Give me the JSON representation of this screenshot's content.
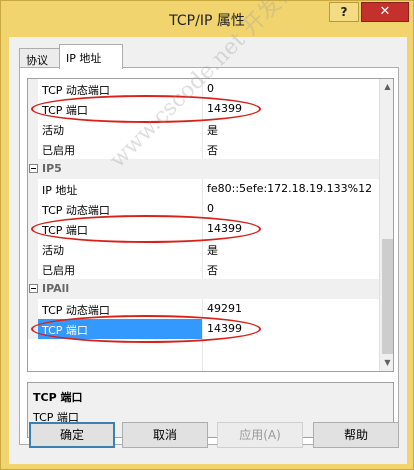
{
  "window": {
    "title": "TCP/IP 属性",
    "help_button": "?",
    "close_button": "✕"
  },
  "tabs": [
    {
      "label": "协议",
      "active": false
    },
    {
      "label": "IP 地址",
      "active": true
    }
  ],
  "grid": {
    "rows": [
      {
        "kind": "prop",
        "name": "TCP 动态端口",
        "value": "0"
      },
      {
        "kind": "prop",
        "name": "TCP 端口",
        "value": "14399",
        "highlighted": true
      },
      {
        "kind": "prop",
        "name": "活动",
        "value": "是"
      },
      {
        "kind": "prop",
        "name": "已启用",
        "value": "否"
      },
      {
        "kind": "category",
        "name": "IP5",
        "expander": "−"
      },
      {
        "kind": "prop",
        "name": "IP 地址",
        "value": "fe80::5efe:172.18.19.133%12"
      },
      {
        "kind": "prop",
        "name": "TCP 动态端口",
        "value": "0"
      },
      {
        "kind": "prop",
        "name": "TCP 端口",
        "value": "14399",
        "highlighted": true
      },
      {
        "kind": "prop",
        "name": "活动",
        "value": "是"
      },
      {
        "kind": "prop",
        "name": "已启用",
        "value": "否"
      },
      {
        "kind": "category",
        "name": "IPAll",
        "expander": "−"
      },
      {
        "kind": "prop",
        "name": "TCP 动态端口",
        "value": "49291"
      },
      {
        "kind": "prop",
        "name": "TCP 端口",
        "value": "14399",
        "highlighted": true,
        "selected": true
      }
    ],
    "scroll_up_arrow": "▲",
    "scroll_down_arrow": "▼"
  },
  "description": {
    "title": "TCP 端口",
    "text": "TCP 端口"
  },
  "buttons": {
    "ok": "确定",
    "cancel": "取消",
    "apply": "应用(A)",
    "help": "帮助"
  },
  "watermark": "www.cscode.net 开发框架文库",
  "colors": {
    "title_bar": "#f2d46e",
    "close_button": "#c4302b",
    "selection": "#3399ff",
    "annotation_ellipse": "#d9211a",
    "default_button_border": "#3c7fb1"
  }
}
